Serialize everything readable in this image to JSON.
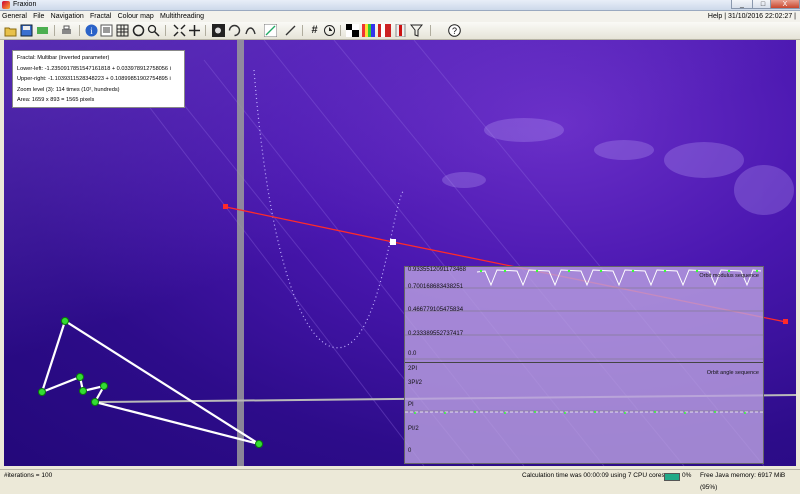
{
  "window": {
    "title": "Fraxion",
    "buttons": [
      "_",
      "□",
      "X"
    ]
  },
  "menu": {
    "items": [
      "General",
      "File",
      "Navigation",
      "Fractal",
      "Colour map",
      "Multithreading"
    ],
    "right_text": "Help | 31/10/2016 22:02:27 |"
  },
  "toolbar": {
    "icons": [
      "open-icon",
      "save-icon",
      "export-icon",
      "print-icon",
      "info-icon",
      "text-icon",
      "grid-icon",
      "orbit-icon",
      "zoom-icon",
      "fit-icon",
      "cross-icon",
      "fractal-1-icon",
      "fractal-2-icon",
      "fractal-3-icon",
      "line-icon",
      "hash-icon",
      "clock-icon",
      "pattern-icon",
      "palette-icon",
      "colours-icon",
      "brush-icon",
      "filter-icon",
      "help-icon"
    ],
    "glyphs": {
      "hash": "#",
      "help": "?",
      "info": "i"
    }
  },
  "info": {
    "fractal": "Fractal: Multibar (inverted parameter)",
    "lower_left": "Lower-left: -1.2350917851547161818 + 0.033978912758056 i",
    "upper_right": "Upper-right: -1.1039311528348223 + 0.10899851902754895 i",
    "zoom": "Zoom level (3): 114 times (10², hundreds)",
    "area": "Area: 1659 x 893 = 1565 pixels"
  },
  "orbit": {
    "modulus_title": "Orbit modulus sequence",
    "modulus_labels": [
      "0.9335512091173468",
      "0.700168683438251",
      "0.466779105475834",
      "0.233389552737417",
      "0.0"
    ],
    "angle_title": "Orbit angle sequence",
    "angle_labels": [
      "2PI",
      "3PI/2",
      "PI",
      "PI/2",
      "0"
    ]
  },
  "status": {
    "iterations": "#iterations = 100",
    "calc": "Calculation time was 00:00:09 using 7 CPU cores",
    "percent": "0%",
    "memory": "Free Java memory: 6917 MiB (95%)"
  },
  "colors": {
    "background": "#3a12a0",
    "path": "#ff2a2a",
    "orbit_points": "#33ff33",
    "polygon": "#ffffff"
  }
}
